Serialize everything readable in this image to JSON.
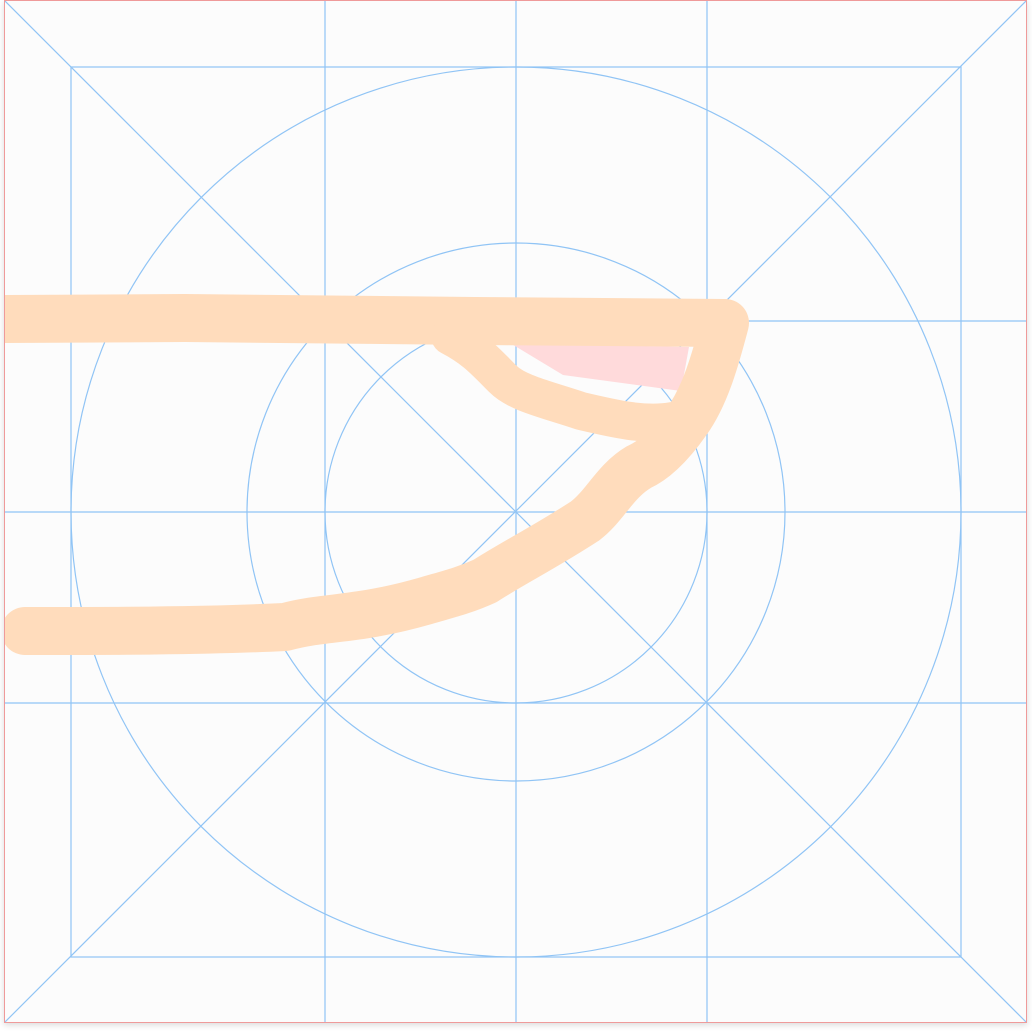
{
  "canvas": {
    "background": "#fcfcfc",
    "border_color": "#ef9a9a",
    "grid_color": "#90c4f5"
  },
  "stroke": {
    "outline_color": "#ffdcbc",
    "fill_color": "#ffdadb"
  },
  "icons": {
    "grid": "keyline-grid",
    "drawing": "freehand-stroke"
  }
}
